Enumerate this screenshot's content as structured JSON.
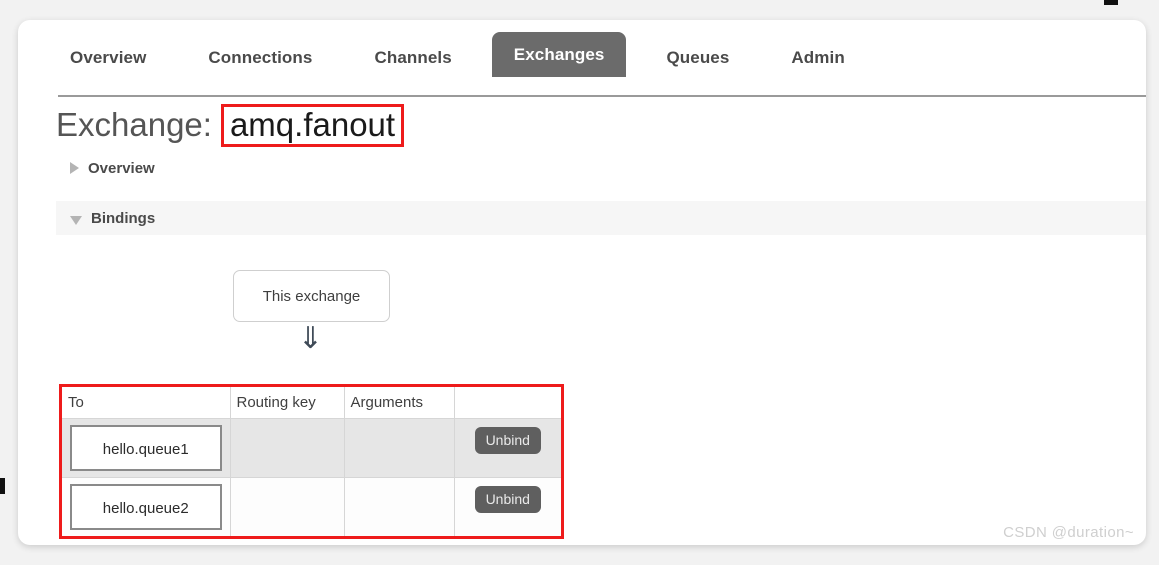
{
  "window": {
    "watermark": "CSDN @duration~"
  },
  "nav": {
    "tabs": [
      {
        "label": "Overview",
        "active": false
      },
      {
        "label": "Connections",
        "active": false
      },
      {
        "label": "Channels",
        "active": false
      },
      {
        "label": "Exchanges",
        "active": true
      },
      {
        "label": "Queues",
        "active": false
      },
      {
        "label": "Admin",
        "active": false
      }
    ],
    "active_tab": "Exchanges",
    "active_tab_bg": "#6b6b6b"
  },
  "page": {
    "title_label": "Exchange:",
    "title_value": "amq.fanout",
    "highlight_color": "#ee1b1b"
  },
  "sections": {
    "overview": {
      "label": "Overview",
      "expanded": false,
      "icon": "triangle-right-icon"
    },
    "bindings": {
      "label": "Bindings",
      "expanded": true,
      "icon": "triangle-down-icon"
    }
  },
  "diagram": {
    "source_node_label": "This exchange",
    "arrow_glyph": "⇓"
  },
  "bindings_table": {
    "columns": [
      "To",
      "Routing key",
      "Arguments",
      ""
    ],
    "rows": [
      {
        "to": "hello.queue1",
        "routing_key": "",
        "arguments": "",
        "action": "Unbind"
      },
      {
        "to": "hello.queue2",
        "routing_key": "",
        "arguments": "",
        "action": "Unbind"
      }
    ]
  }
}
